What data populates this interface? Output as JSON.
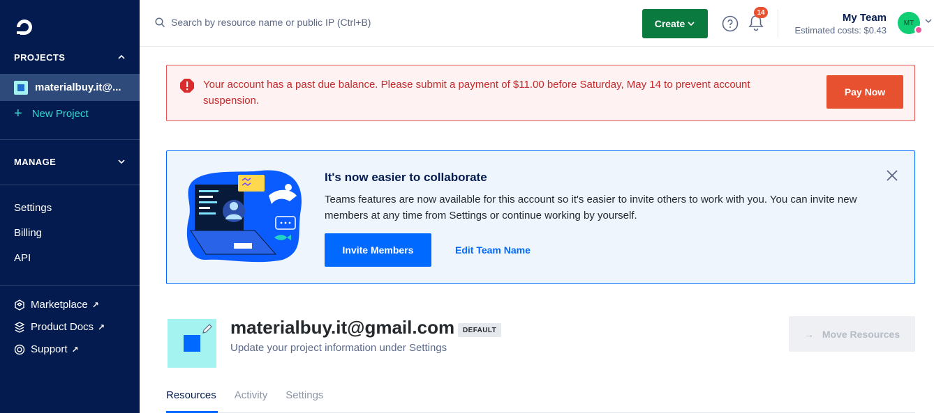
{
  "sidebar": {
    "projects_heading": "PROJECTS",
    "active_project": "materialbuy.it@...",
    "new_project": "New Project",
    "manage_heading": "MANAGE",
    "links": [
      "Settings",
      "Billing",
      "API"
    ],
    "external_links": [
      "Marketplace",
      "Product Docs",
      "Support"
    ]
  },
  "topbar": {
    "search_placeholder": "Search by resource name or public IP (Ctrl+B)",
    "create_label": "Create",
    "notification_count": "14",
    "team_name": "My Team",
    "estimated_costs": "Estimated costs: $0.43",
    "avatar_initials": "MT"
  },
  "alert": {
    "message": "Your account has a past due balance. Please submit a payment of $11.00 before Saturday, May 14 to prevent account suspension.",
    "pay_label": "Pay Now"
  },
  "collab": {
    "title": "It's now easier to collaborate",
    "body": "Teams features are now available for this account so it's easier to invite others to work with you. You can invite new members at any time from Settings or continue working by yourself.",
    "invite_label": "Invite Members",
    "edit_label": "Edit Team Name"
  },
  "project": {
    "title": "materialbuy.it@gmail.com",
    "badge": "DEFAULT",
    "subtitle": "Update your project information under Settings",
    "move_label": "Move Resources"
  },
  "tabs": [
    "Resources",
    "Activity",
    "Settings"
  ],
  "colors": {
    "sidebar_bg": "#031b4e",
    "primary": "#0069ff",
    "create_green": "#0b7a3e",
    "alert_red": "#e8512f",
    "new_project_teal": "#31d9d1"
  }
}
